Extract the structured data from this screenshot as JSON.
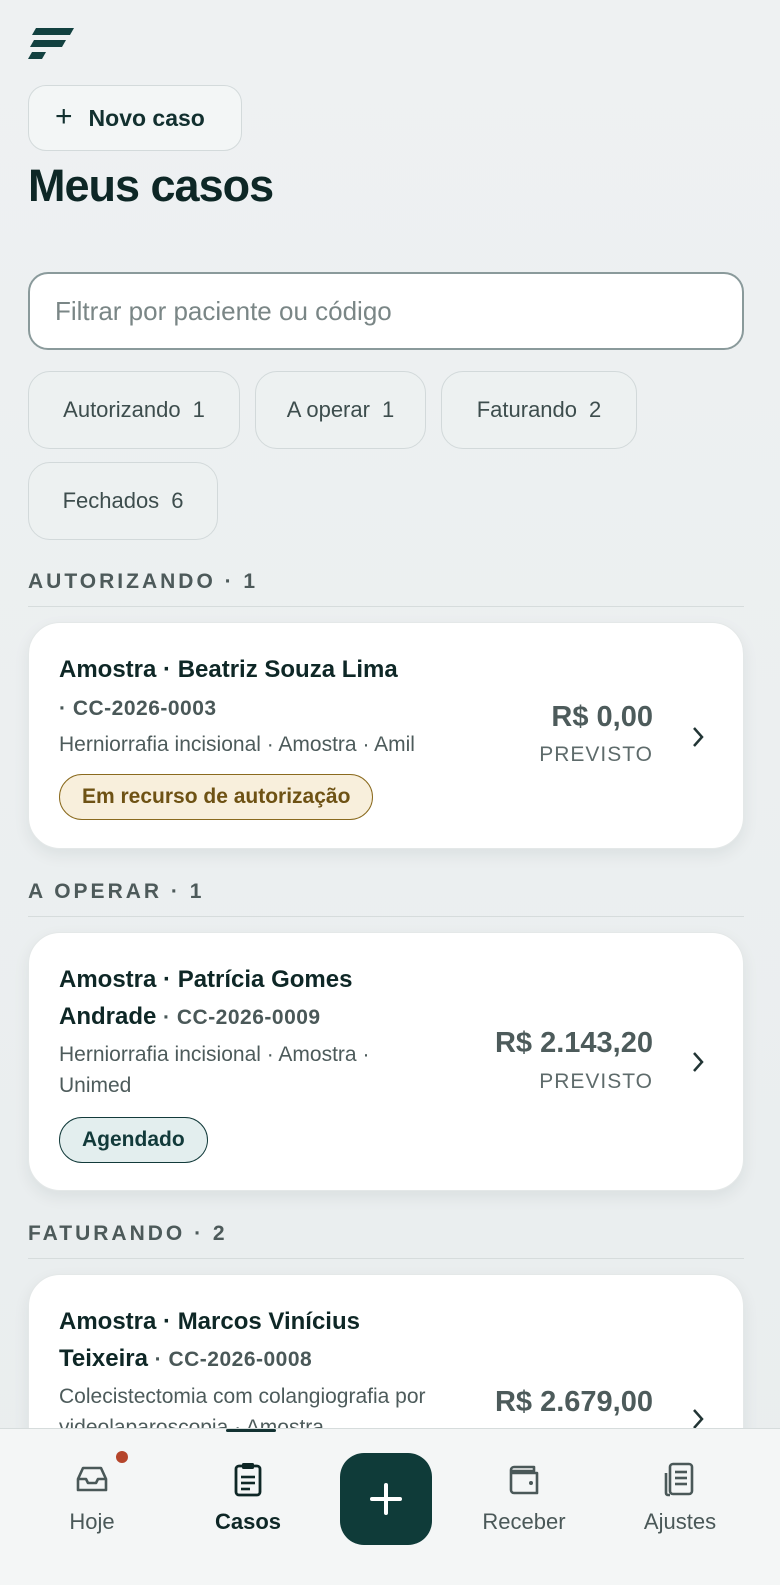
{
  "header": {
    "logo_icon": "brand-logo-icon",
    "new_case_label": "Novo caso",
    "title": "Meus casos"
  },
  "search": {
    "placeholder": "Filtrar por paciente ou código",
    "value": ""
  },
  "filters": [
    {
      "label": "Autorizando",
      "count": "1"
    },
    {
      "label": "A operar",
      "count": "1"
    },
    {
      "label": "Faturando",
      "count": "2"
    },
    {
      "label": "Fechados",
      "count": "6"
    }
  ],
  "sections": [
    {
      "header": "AUTORIZANDO · 1",
      "cards": [
        {
          "name_line": "Amostra · Beatriz Souza Lima",
          "code": "· CC-2026-0003",
          "desc": "Herniorrafia incisional · Amostra · Amil",
          "amount": "R$ 0,00",
          "amount_label": "PREVISTO",
          "badge": "Em recurso de autorização"
        }
      ]
    },
    {
      "header": "A OPERAR · 1",
      "cards": [
        {
          "name_line1": "Amostra · Patrícia Gomes",
          "name_line2": "Andrade",
          "code": "· CC-2026-0009",
          "desc": "Herniorrafia incisional · Amostra · Unimed",
          "amount": "R$ 2.143,20",
          "amount_label": "PREVISTO",
          "badge": "Agendado"
        }
      ]
    },
    {
      "header": "FATURANDO · 2",
      "cards": [
        {
          "name_line1": "Amostra · Marcos Vinícius",
          "name_line2": "Teixeira",
          "code": "· CC-2026-0008",
          "desc": "Colecistectomia com colangiografia por videolaparoscopia · Amostra",
          "amount": "R$ 2.679,00"
        }
      ]
    }
  ],
  "bottom_nav": {
    "items": [
      {
        "label": "Hoje",
        "icon": "inbox-icon",
        "has_notification": true
      },
      {
        "label": "Casos",
        "icon": "clipboard-icon",
        "active": true
      },
      {
        "label": "Receber",
        "icon": "wallet-icon"
      },
      {
        "label": "Ajustes",
        "icon": "document-list-icon"
      }
    ],
    "fab_icon": "plus-icon"
  },
  "colors": {
    "brand": "#0f3b39",
    "warning_badge_bg": "#f8efdc",
    "warning_badge_text": "#6e5214",
    "notification_dot": "#b5452b"
  }
}
